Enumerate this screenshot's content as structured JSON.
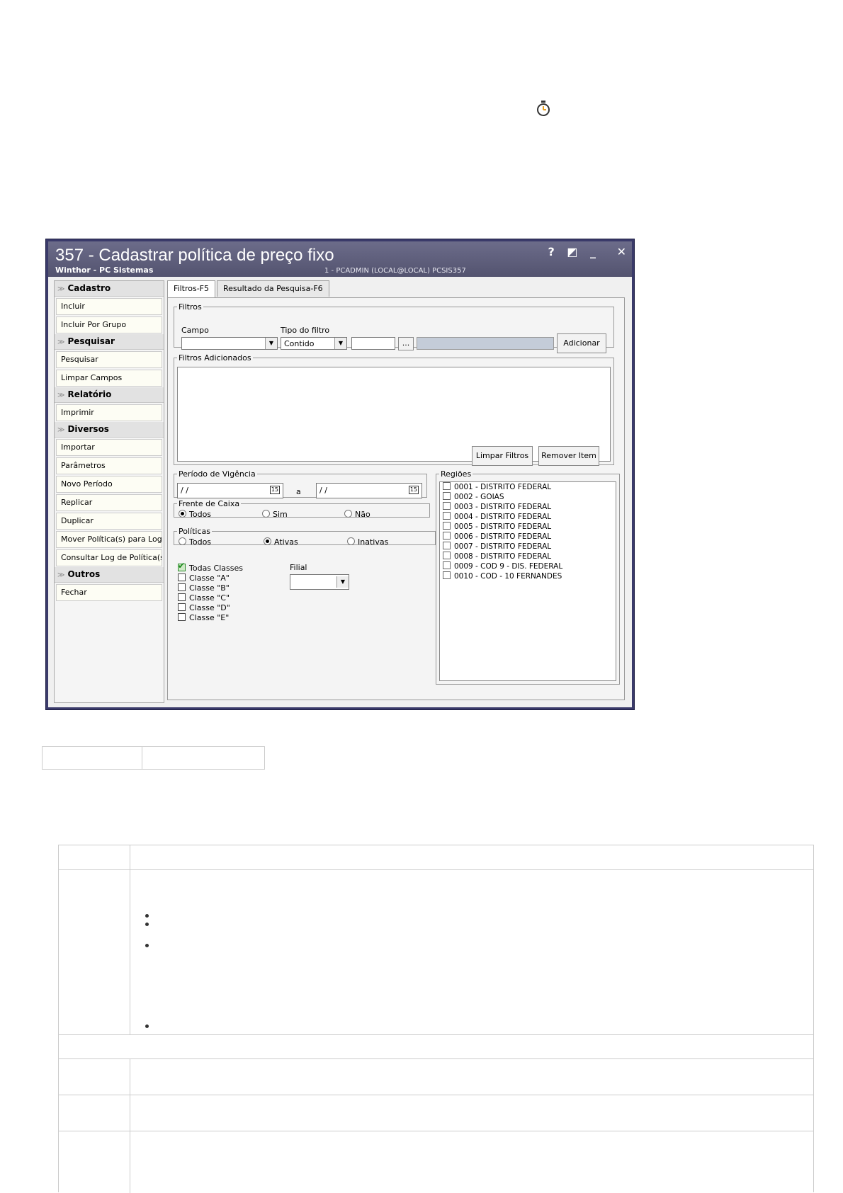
{
  "window": {
    "title": "357 - Cadastrar política de preço fixo",
    "subtitle": "Winthor - PC Sistemas",
    "user_info": "1 - PCADMIN (LOCAL@LOCAL)   PCSIS357",
    "controls": {
      "help": "?",
      "restore": "◩",
      "minimize": "_",
      "close": "✕"
    }
  },
  "sidebar": {
    "sections": [
      {
        "title": "Cadastro",
        "items": [
          "Incluir",
          "Incluir Por Grupo"
        ]
      },
      {
        "title": "Pesquisar",
        "items": [
          "Pesquisar",
          "Limpar Campos"
        ]
      },
      {
        "title": "Relatório",
        "items": [
          "Imprimir"
        ]
      },
      {
        "title": "Diversos",
        "items": [
          "Importar",
          "Parâmetros",
          "Novo Período",
          "Replicar",
          "Duplicar",
          "Mover Política(s) para Log",
          "Consultar Log de Política(s)"
        ]
      },
      {
        "title": "Outros",
        "items": [
          "Fechar"
        ]
      }
    ]
  },
  "tabs": [
    {
      "label": "Filtros-F5",
      "active": true
    },
    {
      "label": "Resultado da Pesquisa-F6",
      "active": false
    }
  ],
  "filtros": {
    "legend": "Filtros",
    "campo_label": "Campo",
    "campo_value": "",
    "tipo_label": "Tipo do filtro",
    "tipo_value": "Contido",
    "valor": "",
    "browse_label": "...",
    "add_button": "Adicionar"
  },
  "filtros_adicionados": {
    "legend": "Filtros Adicionados",
    "clear_button": "Limpar Filtros",
    "remove_button": "Remover Item"
  },
  "periodo": {
    "legend": "Período de Vigência",
    "from": " / /",
    "to": " / /",
    "sep": "a",
    "cal_icon": "15"
  },
  "frente_caixa": {
    "legend": "Frente de Caixa",
    "options": [
      "Todos",
      "Sim",
      "Não"
    ],
    "selected": "Todos"
  },
  "politicas": {
    "legend": "Políticas",
    "options": [
      "Todos",
      "Ativas",
      "Inativas"
    ],
    "selected": "Ativas"
  },
  "classes": {
    "items": [
      {
        "label": "Todas Classes",
        "checked": true
      },
      {
        "label": "Classe \"A\"",
        "checked": false
      },
      {
        "label": "Classe \"B\"",
        "checked": false
      },
      {
        "label": "Classe \"C\"",
        "checked": false
      },
      {
        "label": "Classe \"D\"",
        "checked": false
      },
      {
        "label": "Classe \"E\"",
        "checked": false
      }
    ]
  },
  "filial": {
    "label": "Filial",
    "value": ""
  },
  "regioes": {
    "legend": "Regiões",
    "items": [
      "0001 - DISTRITO FEDERAL",
      "0002 - GOIAS",
      "0003 - DISTRITO FEDERAL",
      "0004 - DISTRITO FEDERAL",
      "0005 - DISTRITO FEDERAL",
      "0006 - DISTRITO FEDERAL",
      "0007 - DISTRITO FEDERAL",
      "0008 - DISTRITO FEDERAL",
      "0009 - COD 9 - DIS. FEDERAL",
      "0010 - COD - 10 FERNANDES"
    ]
  },
  "colors": {
    "titlebar": "#5f5f7d",
    "frame": "#3a3a6a",
    "timer_icon": "#e8a020"
  }
}
